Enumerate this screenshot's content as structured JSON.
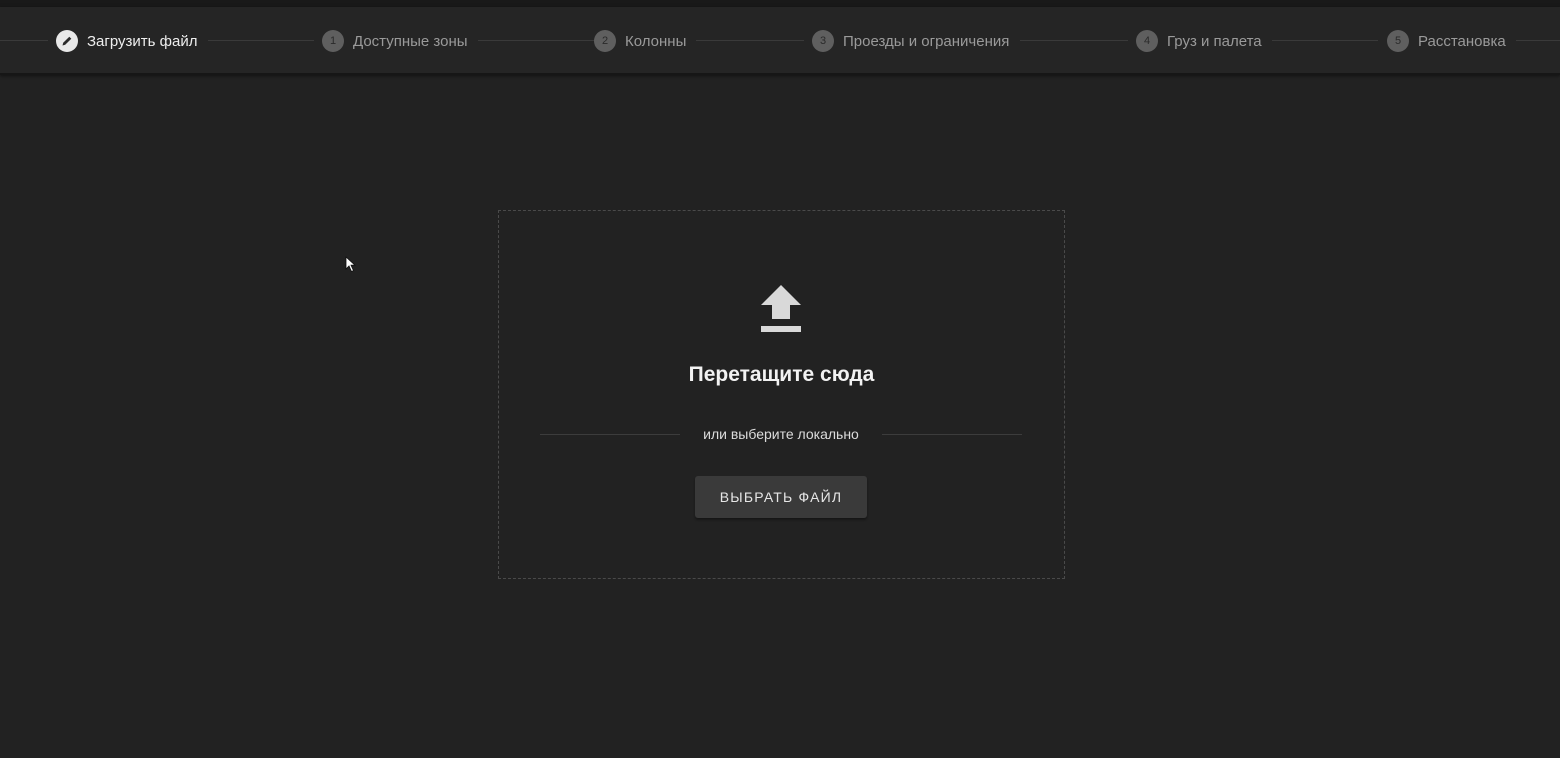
{
  "stepper": {
    "steps": [
      {
        "number": "",
        "label": "Загрузить файл",
        "icon": "pencil-icon",
        "active": true
      },
      {
        "number": "1",
        "label": "Доступные зоны",
        "active": false
      },
      {
        "number": "2",
        "label": "Колонны",
        "active": false
      },
      {
        "number": "3",
        "label": "Проезды и ограничения",
        "active": false
      },
      {
        "number": "4",
        "label": "Груз и палета",
        "active": false
      },
      {
        "number": "5",
        "label": "Расстановка",
        "active": false
      }
    ]
  },
  "dropzone": {
    "icon": "upload-icon",
    "title": "Перетащите сюда",
    "divider_text": "или выберите локально",
    "button_label": "ВЫБРАТЬ ФАЙЛ"
  },
  "colors": {
    "background": "#222222",
    "stepper_bg": "#252525",
    "active_step": "#e8e8e8",
    "inactive_step": "#5f5f5f",
    "button_bg": "#3a3a3a"
  }
}
